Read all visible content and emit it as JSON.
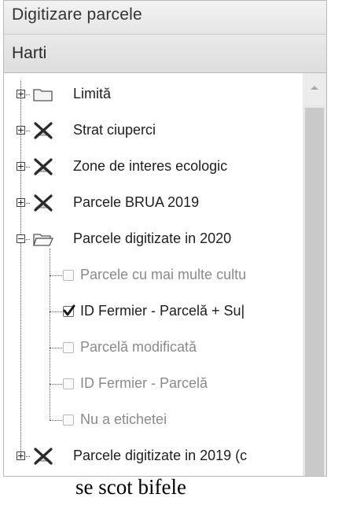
{
  "panel_title": "Digitizare parcele",
  "section_title": "Harti",
  "tree": [
    {
      "label": "Limită",
      "icon": "folder-closed-icon",
      "state": "collapsed"
    },
    {
      "label": "Strat ciuperci",
      "icon": "layer-x-icon",
      "state": "collapsed"
    },
    {
      "label": "Zone de interes ecologic",
      "icon": "layer-x-icon",
      "state": "collapsed"
    },
    {
      "label": "Parcele BRUA 2019",
      "icon": "layer-x-icon",
      "state": "collapsed"
    },
    {
      "label": "Parcele digitizate in 2020",
      "icon": "folder-open-icon",
      "state": "expanded",
      "children": [
        {
          "label": "Parcele cu mai multe cultu",
          "checked": false
        },
        {
          "label": "ID Fermier - Parcelă + Su|",
          "checked": true
        },
        {
          "label": "Parcelă modificată",
          "checked": false
        },
        {
          "label": "ID Fermier - Parcelă",
          "checked": false
        },
        {
          "label": "Nu a etichetei",
          "checked": false
        }
      ]
    },
    {
      "label": "Parcele digitizate in 2019 (c",
      "icon": "layer-x-icon",
      "state": "collapsed"
    }
  ],
  "caption": "se scot bifele",
  "colors": {
    "text_dark": "#1e1e1e",
    "text_disabled": "#8a8a8a",
    "check": "#1a1a1a"
  }
}
